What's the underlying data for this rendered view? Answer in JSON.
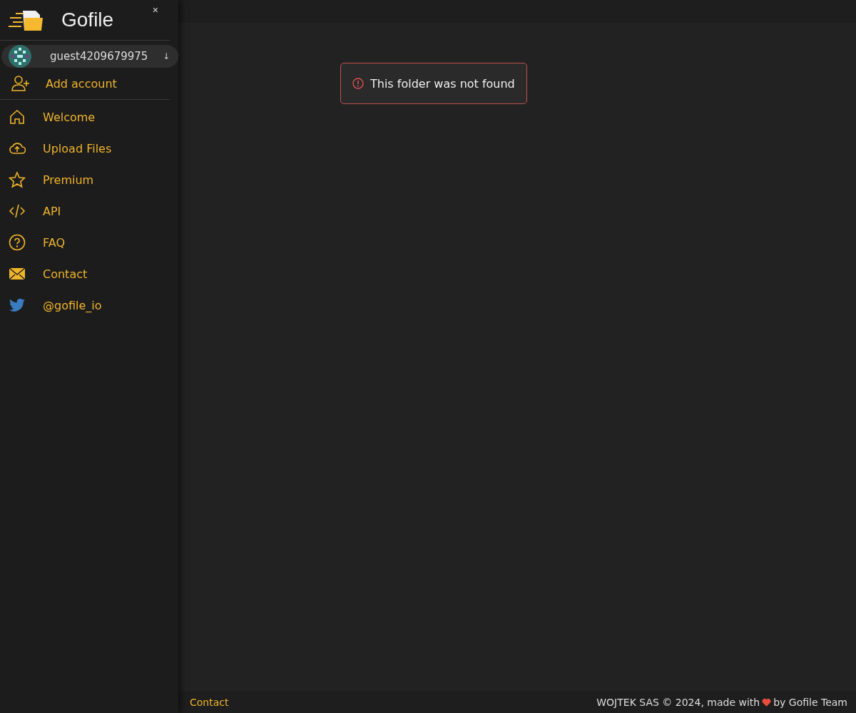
{
  "sidebar": {
    "brand": "Gofile",
    "close": "×",
    "account": {
      "name": "guest4209679975",
      "caret": "↓"
    },
    "add_account": "Add account",
    "items": [
      {
        "kind": "home",
        "label": "Welcome"
      },
      {
        "kind": "upload",
        "label": "Upload Files"
      },
      {
        "kind": "star",
        "label": "Premium"
      },
      {
        "kind": "code",
        "label": "API"
      },
      {
        "kind": "help",
        "label": "FAQ"
      },
      {
        "kind": "mail",
        "label": "Contact"
      },
      {
        "kind": "bird",
        "label": "@gofile_io"
      }
    ]
  },
  "alert": {
    "message": "This folder was not found"
  },
  "footer": {
    "link": "Contact",
    "credit_before": "WOJTEK SAS © 2024, made with",
    "credit_after": "by Gofile Team"
  }
}
